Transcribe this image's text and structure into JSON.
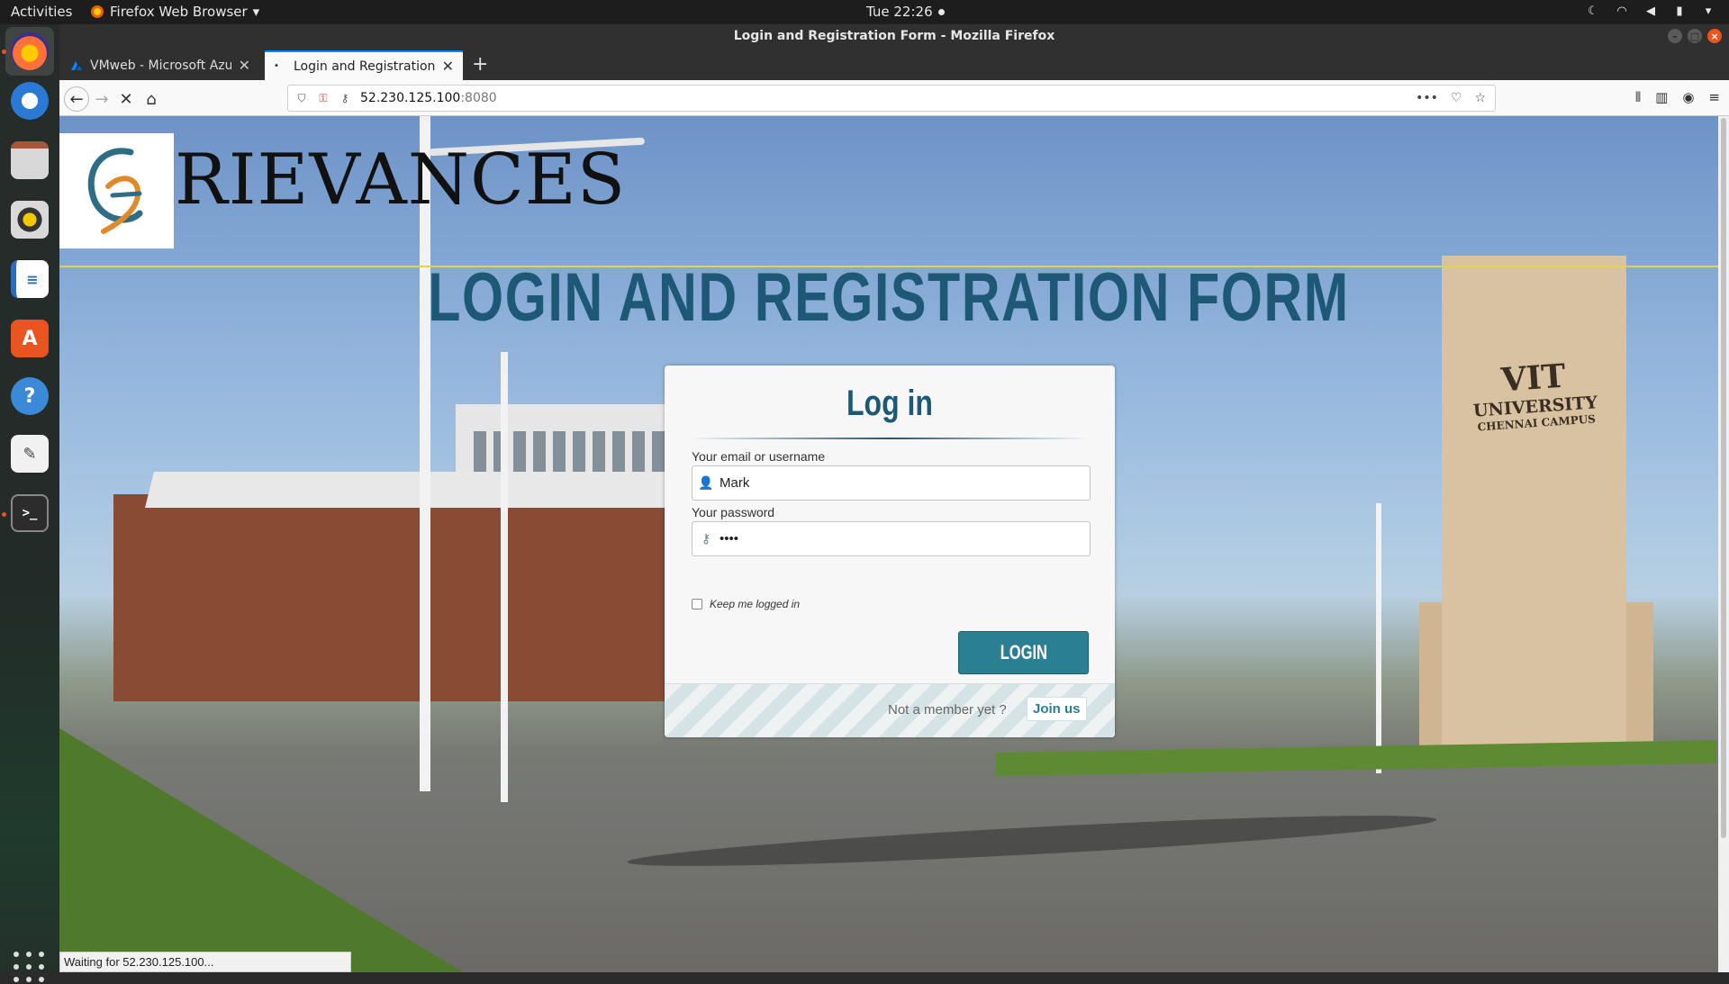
{
  "system": {
    "activities": "Activities",
    "app_menu": "Firefox Web Browser",
    "clock": "Tue 22:26"
  },
  "window": {
    "title": "Login and Registration Form - Mozilla Firefox"
  },
  "tabs": [
    {
      "title": "VMweb - Microsoft Azure"
    },
    {
      "title": "Login and Registration Form"
    }
  ],
  "navbar": {
    "url_host": "52.230.125.100",
    "url_port": ":8080"
  },
  "site": {
    "title": "RIEVANCES",
    "heading": "LOGIN AND REGISTRATION FORM",
    "campus_sign": {
      "line1": "VIT",
      "line2": "UNIVERSITY",
      "line3": "CHENNAI CAMPUS"
    }
  },
  "login": {
    "title": "Log in",
    "username_label": "Your email or username",
    "username_value": "Mark",
    "password_label": "Your password",
    "password_value": "••••",
    "remember_label": "Keep me logged in",
    "login_button": "LOGIN",
    "not_member": "Not a member yet ?",
    "join_link": "Join us"
  },
  "status_bar": "Waiting for 52.230.125.100...",
  "colors": {
    "heading": "#1e5877",
    "button": "#2b7f93",
    "accent_line": "#e2d54a",
    "tab_accent": "#0a84ff"
  }
}
